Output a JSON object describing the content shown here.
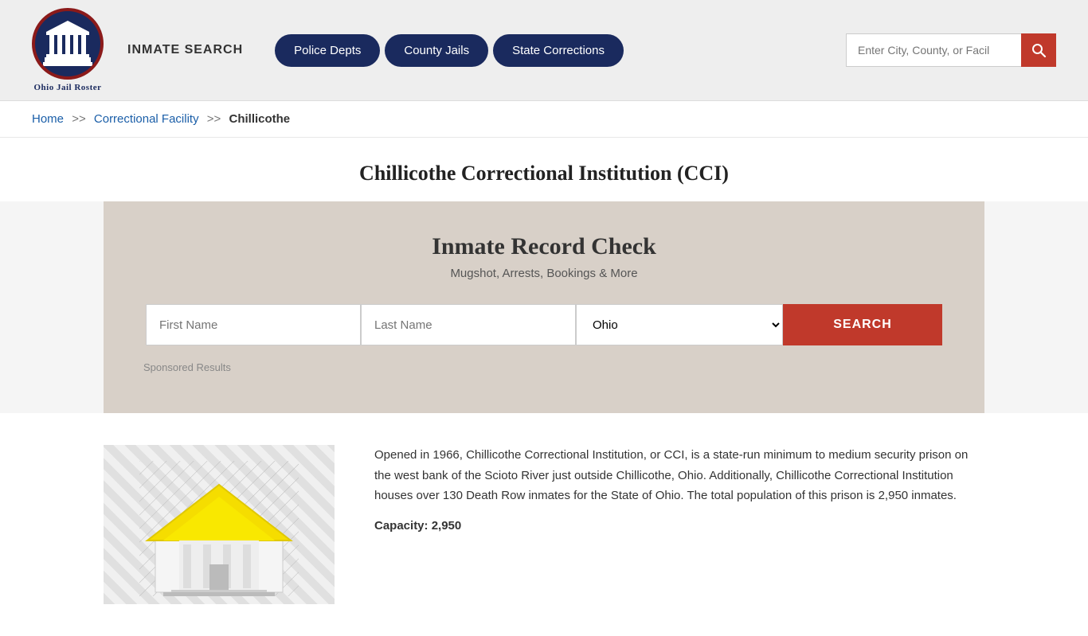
{
  "header": {
    "logo_alt": "Ohio Jail Roster",
    "logo_text_line1": "Ohio Jail Roster",
    "inmate_search_label": "INMATE SEARCH",
    "nav_buttons": [
      {
        "label": "Police Depts",
        "id": "police-depts"
      },
      {
        "label": "County Jails",
        "id": "county-jails"
      },
      {
        "label": "State Corrections",
        "id": "state-corrections"
      }
    ],
    "search_placeholder": "Enter City, County, or Facil"
  },
  "breadcrumb": {
    "home": "Home",
    "separator": ">>",
    "correctional_facility": "Correctional Facility",
    "current": "Chillicothe"
  },
  "page": {
    "title": "Chillicothe Correctional Institution (CCI)"
  },
  "record_check": {
    "heading": "Inmate Record Check",
    "subheading": "Mugshot, Arrests, Bookings & More",
    "first_name_placeholder": "First Name",
    "last_name_placeholder": "Last Name",
    "state_default": "Ohio",
    "search_button": "SEARCH",
    "sponsored_label": "Sponsored Results"
  },
  "description": {
    "text": "Opened in 1966, Chillicothe Correctional Institution, or CCI, is a state-run minimum to medium security prison on the west bank of the Scioto River just outside Chillicothe, Ohio. Additionally, Chillicothe Correctional Institution houses over 130 Death Row inmates for the State of Ohio. The total population of this prison is 2,950 inmates.",
    "capacity_label": "Capacity: 2,950"
  },
  "colors": {
    "nav_bg": "#1a2a5e",
    "search_btn_bg": "#c0392b",
    "breadcrumb_link": "#1a5ea8",
    "record_check_bg": "#d8d0c8"
  }
}
